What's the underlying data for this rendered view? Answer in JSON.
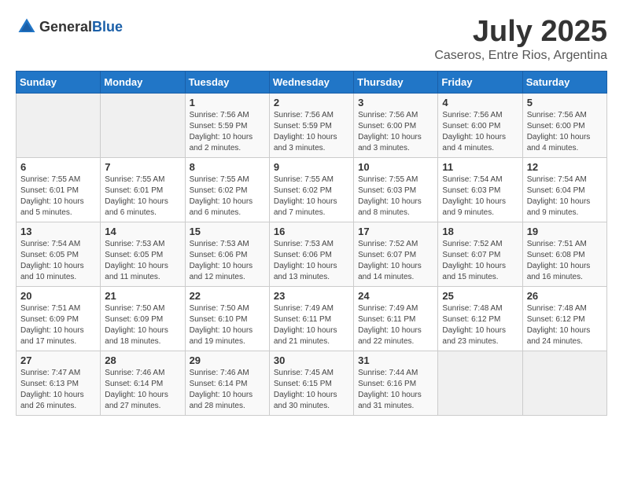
{
  "header": {
    "logo_general": "General",
    "logo_blue": "Blue",
    "title": "July 2025",
    "subtitle": "Caseros, Entre Rios, Argentina"
  },
  "weekdays": [
    "Sunday",
    "Monday",
    "Tuesday",
    "Wednesday",
    "Thursday",
    "Friday",
    "Saturday"
  ],
  "weeks": [
    [
      {
        "day": "",
        "info": ""
      },
      {
        "day": "",
        "info": ""
      },
      {
        "day": "1",
        "info": "Sunrise: 7:56 AM\nSunset: 5:59 PM\nDaylight: 10 hours and 2 minutes."
      },
      {
        "day": "2",
        "info": "Sunrise: 7:56 AM\nSunset: 5:59 PM\nDaylight: 10 hours and 3 minutes."
      },
      {
        "day": "3",
        "info": "Sunrise: 7:56 AM\nSunset: 6:00 PM\nDaylight: 10 hours and 3 minutes."
      },
      {
        "day": "4",
        "info": "Sunrise: 7:56 AM\nSunset: 6:00 PM\nDaylight: 10 hours and 4 minutes."
      },
      {
        "day": "5",
        "info": "Sunrise: 7:56 AM\nSunset: 6:00 PM\nDaylight: 10 hours and 4 minutes."
      }
    ],
    [
      {
        "day": "6",
        "info": "Sunrise: 7:55 AM\nSunset: 6:01 PM\nDaylight: 10 hours and 5 minutes."
      },
      {
        "day": "7",
        "info": "Sunrise: 7:55 AM\nSunset: 6:01 PM\nDaylight: 10 hours and 6 minutes."
      },
      {
        "day": "8",
        "info": "Sunrise: 7:55 AM\nSunset: 6:02 PM\nDaylight: 10 hours and 6 minutes."
      },
      {
        "day": "9",
        "info": "Sunrise: 7:55 AM\nSunset: 6:02 PM\nDaylight: 10 hours and 7 minutes."
      },
      {
        "day": "10",
        "info": "Sunrise: 7:55 AM\nSunset: 6:03 PM\nDaylight: 10 hours and 8 minutes."
      },
      {
        "day": "11",
        "info": "Sunrise: 7:54 AM\nSunset: 6:03 PM\nDaylight: 10 hours and 9 minutes."
      },
      {
        "day": "12",
        "info": "Sunrise: 7:54 AM\nSunset: 6:04 PM\nDaylight: 10 hours and 9 minutes."
      }
    ],
    [
      {
        "day": "13",
        "info": "Sunrise: 7:54 AM\nSunset: 6:05 PM\nDaylight: 10 hours and 10 minutes."
      },
      {
        "day": "14",
        "info": "Sunrise: 7:53 AM\nSunset: 6:05 PM\nDaylight: 10 hours and 11 minutes."
      },
      {
        "day": "15",
        "info": "Sunrise: 7:53 AM\nSunset: 6:06 PM\nDaylight: 10 hours and 12 minutes."
      },
      {
        "day": "16",
        "info": "Sunrise: 7:53 AM\nSunset: 6:06 PM\nDaylight: 10 hours and 13 minutes."
      },
      {
        "day": "17",
        "info": "Sunrise: 7:52 AM\nSunset: 6:07 PM\nDaylight: 10 hours and 14 minutes."
      },
      {
        "day": "18",
        "info": "Sunrise: 7:52 AM\nSunset: 6:07 PM\nDaylight: 10 hours and 15 minutes."
      },
      {
        "day": "19",
        "info": "Sunrise: 7:51 AM\nSunset: 6:08 PM\nDaylight: 10 hours and 16 minutes."
      }
    ],
    [
      {
        "day": "20",
        "info": "Sunrise: 7:51 AM\nSunset: 6:09 PM\nDaylight: 10 hours and 17 minutes."
      },
      {
        "day": "21",
        "info": "Sunrise: 7:50 AM\nSunset: 6:09 PM\nDaylight: 10 hours and 18 minutes."
      },
      {
        "day": "22",
        "info": "Sunrise: 7:50 AM\nSunset: 6:10 PM\nDaylight: 10 hours and 19 minutes."
      },
      {
        "day": "23",
        "info": "Sunrise: 7:49 AM\nSunset: 6:11 PM\nDaylight: 10 hours and 21 minutes."
      },
      {
        "day": "24",
        "info": "Sunrise: 7:49 AM\nSunset: 6:11 PM\nDaylight: 10 hours and 22 minutes."
      },
      {
        "day": "25",
        "info": "Sunrise: 7:48 AM\nSunset: 6:12 PM\nDaylight: 10 hours and 23 minutes."
      },
      {
        "day": "26",
        "info": "Sunrise: 7:48 AM\nSunset: 6:12 PM\nDaylight: 10 hours and 24 minutes."
      }
    ],
    [
      {
        "day": "27",
        "info": "Sunrise: 7:47 AM\nSunset: 6:13 PM\nDaylight: 10 hours and 26 minutes."
      },
      {
        "day": "28",
        "info": "Sunrise: 7:46 AM\nSunset: 6:14 PM\nDaylight: 10 hours and 27 minutes."
      },
      {
        "day": "29",
        "info": "Sunrise: 7:46 AM\nSunset: 6:14 PM\nDaylight: 10 hours and 28 minutes."
      },
      {
        "day": "30",
        "info": "Sunrise: 7:45 AM\nSunset: 6:15 PM\nDaylight: 10 hours and 30 minutes."
      },
      {
        "day": "31",
        "info": "Sunrise: 7:44 AM\nSunset: 6:16 PM\nDaylight: 10 hours and 31 minutes."
      },
      {
        "day": "",
        "info": ""
      },
      {
        "day": "",
        "info": ""
      }
    ]
  ]
}
